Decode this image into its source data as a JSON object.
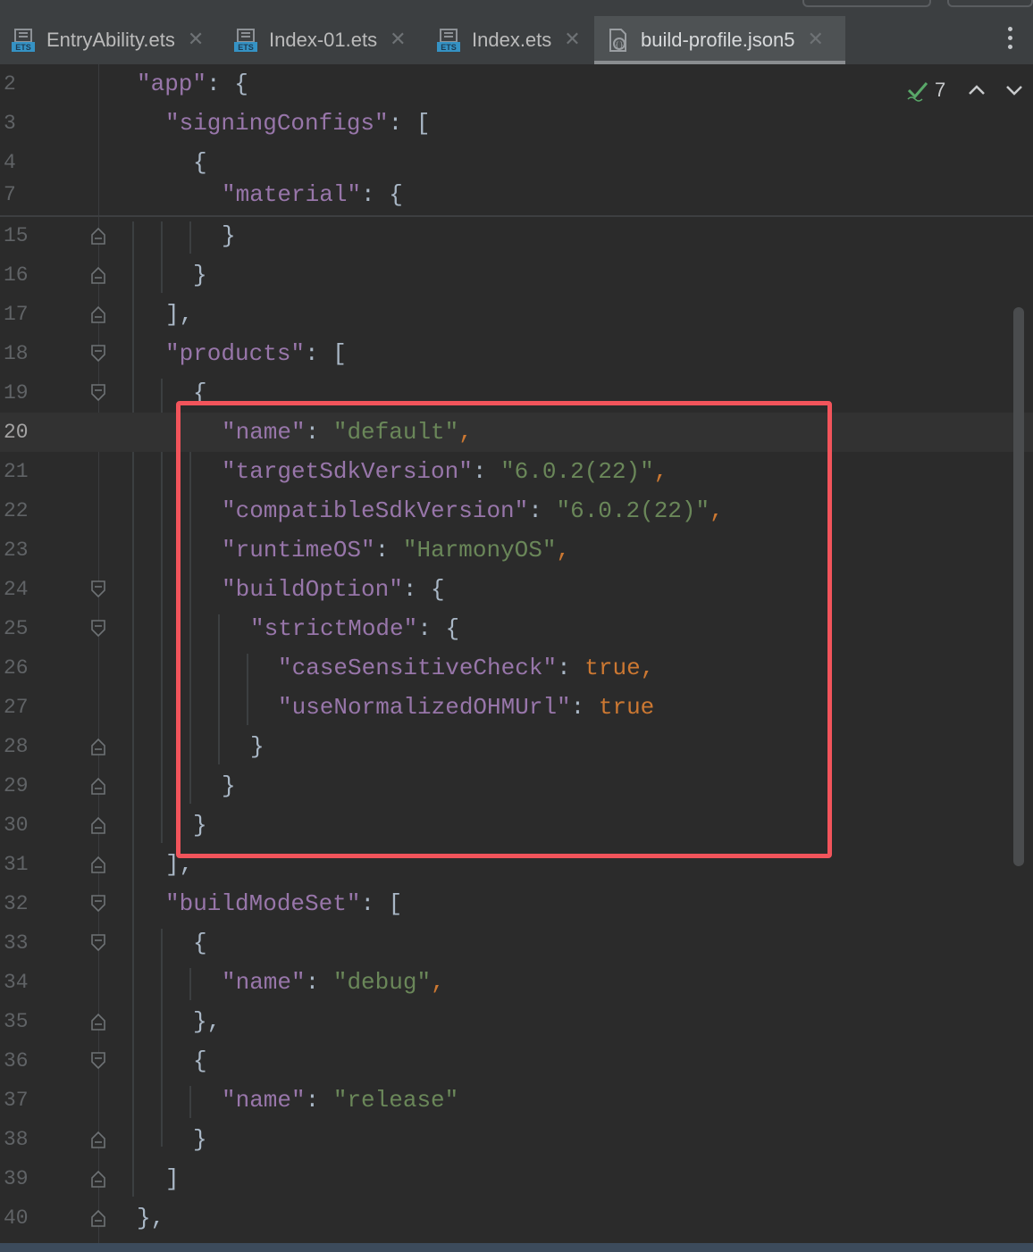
{
  "tabs": [
    {
      "label": "EntryAbility.ets",
      "icon": "ets-file-icon",
      "active": false
    },
    {
      "label": "Index-01.ets",
      "icon": "ets-file-icon",
      "active": false
    },
    {
      "label": "Index.ets",
      "icon": "ets-file-icon",
      "active": false
    },
    {
      "label": "build-profile.json5",
      "icon": "json5-file-icon",
      "active": true
    }
  ],
  "tab_close_glyph": "✕",
  "inspection": {
    "count": "7"
  },
  "lines": [
    {
      "n": "2",
      "indent": 0
    },
    {
      "n": "3",
      "indent": 0
    },
    {
      "n": "4",
      "indent": 0
    },
    {
      "n": "7",
      "indent": 0
    },
    {
      "n": "15",
      "indent": 0
    },
    {
      "n": "16",
      "indent": 0
    },
    {
      "n": "17",
      "indent": 0
    },
    {
      "n": "18",
      "indent": 0
    },
    {
      "n": "19",
      "indent": 0
    },
    {
      "n": "20",
      "indent": 0
    },
    {
      "n": "21",
      "indent": 0
    },
    {
      "n": "22",
      "indent": 0
    },
    {
      "n": "23",
      "indent": 0
    },
    {
      "n": "24",
      "indent": 0
    },
    {
      "n": "25",
      "indent": 0
    },
    {
      "n": "26",
      "indent": 0
    },
    {
      "n": "27",
      "indent": 0
    },
    {
      "n": "28",
      "indent": 0
    },
    {
      "n": "29",
      "indent": 0
    },
    {
      "n": "30",
      "indent": 0
    },
    {
      "n": "31",
      "indent": 0
    },
    {
      "n": "32",
      "indent": 0
    },
    {
      "n": "33",
      "indent": 0
    },
    {
      "n": "34",
      "indent": 0
    },
    {
      "n": "35",
      "indent": 0
    },
    {
      "n": "36",
      "indent": 0
    },
    {
      "n": "37",
      "indent": 0
    },
    {
      "n": "38",
      "indent": 0
    },
    {
      "n": "39",
      "indent": 0
    },
    {
      "n": "40",
      "indent": 0
    }
  ],
  "code": {
    "l2_key": "\"app\"",
    "l2_rest": ": {",
    "l3_key": "\"signingConfigs\"",
    "l3_rest": ": [",
    "l4": "{",
    "l7_key": "\"material\"",
    "l7_rest": ": {",
    "l15": "}",
    "l16": "}",
    "l17": "],",
    "l18_key": "\"products\"",
    "l18_rest": ": [",
    "l19": "{",
    "l20_key": "\"name\"",
    "l20_val": "\"default\"",
    "l21_key": "\"targetSdkVersion\"",
    "l21_val": "\"6.0.2(22)\"",
    "l22_key": "\"compatibleSdkVersion\"",
    "l22_val": "\"6.0.2(22)\"",
    "l23_key": "\"runtimeOS\"",
    "l23_val": "\"HarmonyOS\"",
    "l24_key": "\"buildOption\"",
    "l24_rest": ": {",
    "l25_key": "\"strictMode\"",
    "l25_rest": ": {",
    "l26_key": "\"caseSensitiveCheck\"",
    "l26_val": "true",
    "l27_key": "\"useNormalizedOHMUrl\"",
    "l27_val": "true",
    "l28": "}",
    "l29": "}",
    "l30": "}",
    "l31": "],",
    "l32_key": "\"buildModeSet\"",
    "l32_rest": ": [",
    "l33": "{",
    "l34_key": "\"name\"",
    "l34_val": "\"debug\"",
    "l35": "},",
    "l36": "{",
    "l37_key": "\"name\"",
    "l37_val": "\"release\"",
    "l38": "}",
    "l39": "]",
    "l40": "},"
  },
  "colors": {
    "background": "#2b2b2b",
    "key": "#9876aa",
    "string": "#6a8759",
    "boolean": "#cc7832",
    "punctuation": "#a9b7c6",
    "highlight_box": "#f2545b",
    "inspection_ok": "#59a869"
  }
}
